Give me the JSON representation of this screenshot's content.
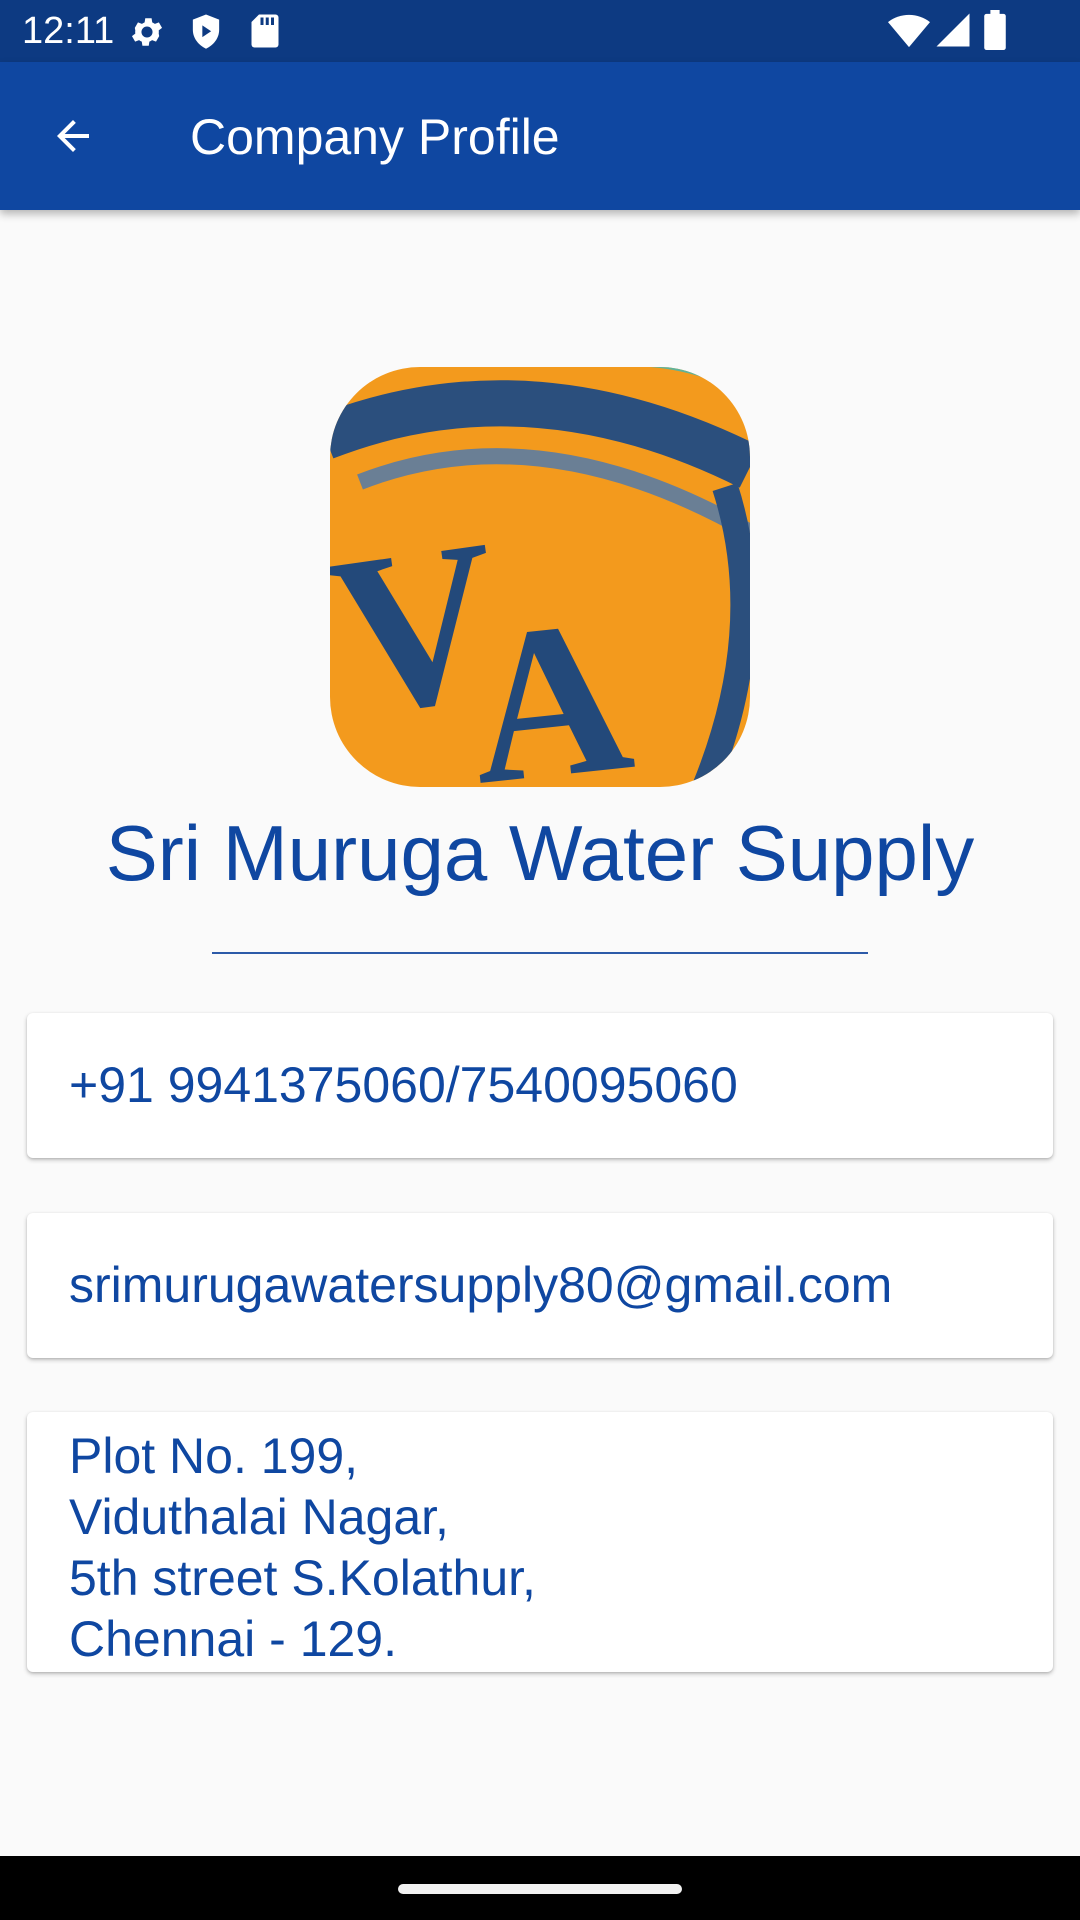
{
  "status_bar": {
    "time": "12:11",
    "left_icons": [
      "settings-icon",
      "shield-play-icon",
      "sd-card-icon"
    ],
    "right_icons": [
      "wifi-icon",
      "cellular-signal-icon",
      "battery-icon"
    ]
  },
  "app_bar": {
    "back_icon": "arrow-back-icon",
    "title": "Company Profile",
    "background_color": "#0f47a1"
  },
  "logo": {
    "letters": "VA",
    "background_color": "#f39a1d",
    "letter_color": "#23497a"
  },
  "company": {
    "name": "Sri Muruga Water Supply",
    "phone": "+91 9941375060/7540095060",
    "email": "srimurugawatersupply80@gmail.com",
    "address_lines": [
      "Plot No. 199,",
      "Viduthalai Nagar,",
      "5th street S.Kolathur,",
      "Chennai - 129."
    ]
  },
  "theme": {
    "primary": "#0f47a1",
    "status_bar": "#0d3a82",
    "background": "#fafafa"
  }
}
